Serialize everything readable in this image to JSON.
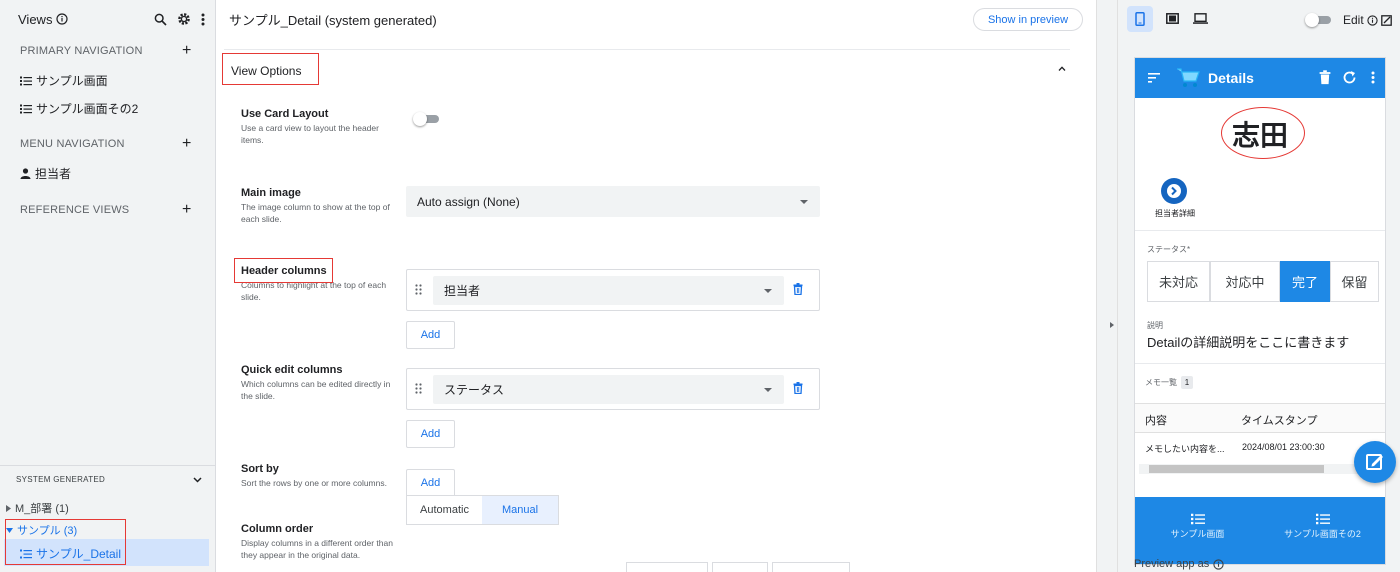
{
  "sidebar": {
    "title": "Views",
    "sections": {
      "primary": "PRIMARY NAVIGATION",
      "menu": "MENU NAVIGATION",
      "reference": "REFERENCE VIEWS"
    },
    "primary_items": [
      "サンプル画面",
      "サンプル画面その2"
    ],
    "menu_items": [
      "担当者"
    ],
    "system_generated": "SYSTEM GENERATED",
    "tree": {
      "dept": "M_部署 (1)",
      "sample_group": "サンプル (3)",
      "sample_detail": "サンプル_Detail"
    }
  },
  "main": {
    "title": "サンプル_Detail (system generated)",
    "show_in_preview": "Show in preview",
    "view_options": "View Options",
    "fields": {
      "card_layout": {
        "title": "Use Card Layout",
        "desc": "Use a card view to layout the header items."
      },
      "main_image": {
        "title": "Main image",
        "desc": "The image column to show at the top of each slide.",
        "value": "Auto assign (None)"
      },
      "header_columns": {
        "title": "Header columns",
        "desc": "Columns to highlight at the top of each slide.",
        "value": "担当者",
        "add": "Add"
      },
      "quick_edit": {
        "title": "Quick edit columns",
        "desc": "Which columns can be edited directly in the slide.",
        "value": "ステータス",
        "add": "Add"
      },
      "sort_by": {
        "title": "Sort by",
        "desc": "Sort the rows by one or more columns.",
        "add": "Add"
      },
      "column_order": {
        "title": "Column order",
        "desc": "Display columns in a different order than they appear in the original data.",
        "automatic": "Automatic",
        "manual": "Manual"
      }
    }
  },
  "preview": {
    "edit_label": "Edit",
    "app_title": "Details",
    "hero": "志田",
    "action_label": "担当者詳細",
    "status_label": "ステータス*",
    "status_options": [
      "未対応",
      "対応中",
      "完了",
      "保留"
    ],
    "status_selected": "完了",
    "desc_label": "説明",
    "desc_value": "Detailの詳細説明をここに書きます",
    "memo_label": "メモ一覧",
    "memo_count": "1",
    "table_headers": [
      "内容",
      "タイムスタンプ"
    ],
    "table_row": [
      "メモしたい内容を...",
      "2024/08/01 23:00:30"
    ],
    "bottom_nav": [
      "サンプル画面",
      "サンプル画面その2"
    ],
    "preview_as": "Preview app as"
  },
  "colors": {
    "accent": "#1a73e8",
    "app_bar": "#1e88e5",
    "highlight_box": "#e53935"
  }
}
